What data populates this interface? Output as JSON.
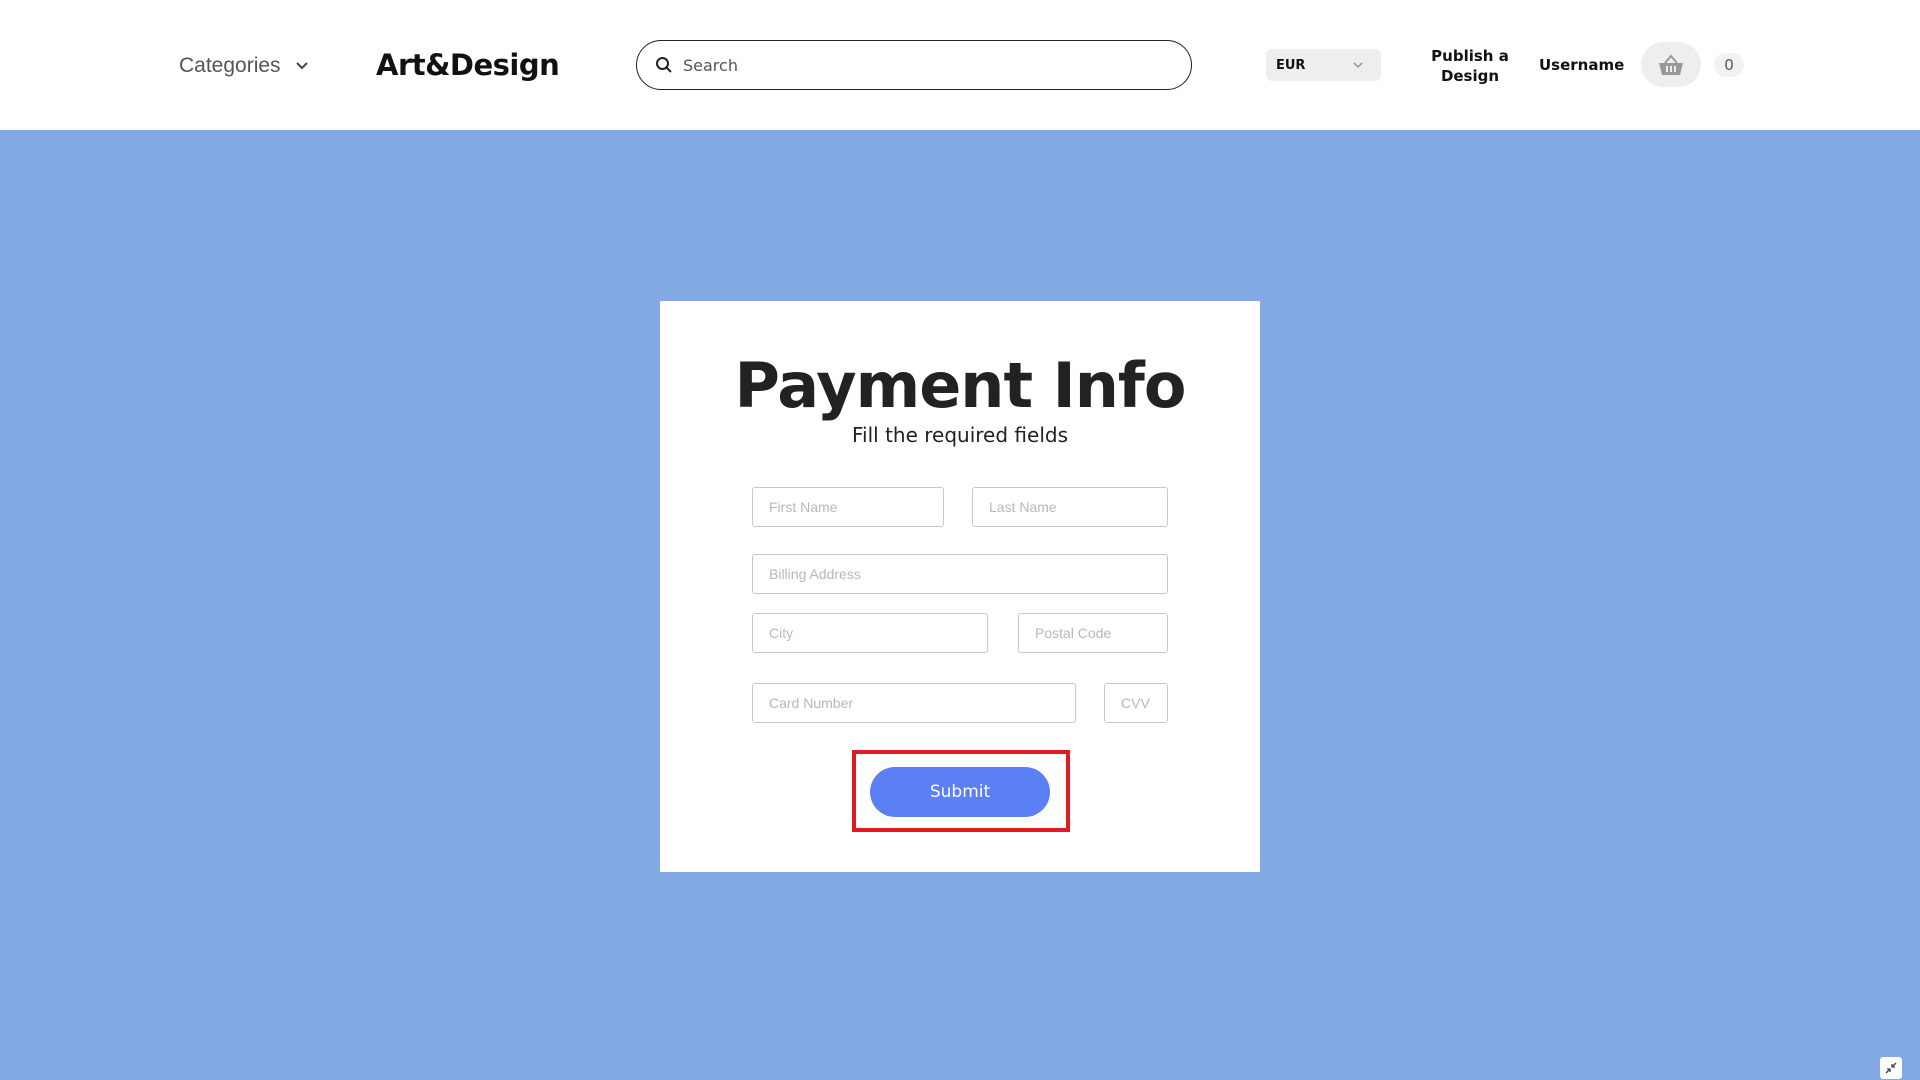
{
  "header": {
    "categories_label": "Categories",
    "logo": "Art&Design",
    "search_placeholder": "Search",
    "currency": "EUR",
    "publish_label": "Publish a Design",
    "username": "Username",
    "cart_count": "0"
  },
  "form": {
    "title": "Payment Info",
    "subtitle": "Fill the required fields",
    "first_name_placeholder": "First Name",
    "last_name_placeholder": "Last Name",
    "billing_address_placeholder": "Billing Address",
    "city_placeholder": "City",
    "postal_code_placeholder": "Postal Code",
    "card_number_placeholder": "Card Number",
    "cvv_placeholder": "CVV",
    "submit_label": "Submit"
  },
  "icons": {
    "search": "search-icon",
    "chevron": "chevron-down-icon",
    "basket": "basket-icon",
    "collapse": "collapse-icon"
  },
  "colors": {
    "background": "#82a9e3",
    "submit": "#5b7ff5",
    "highlight": "#e21b23"
  }
}
